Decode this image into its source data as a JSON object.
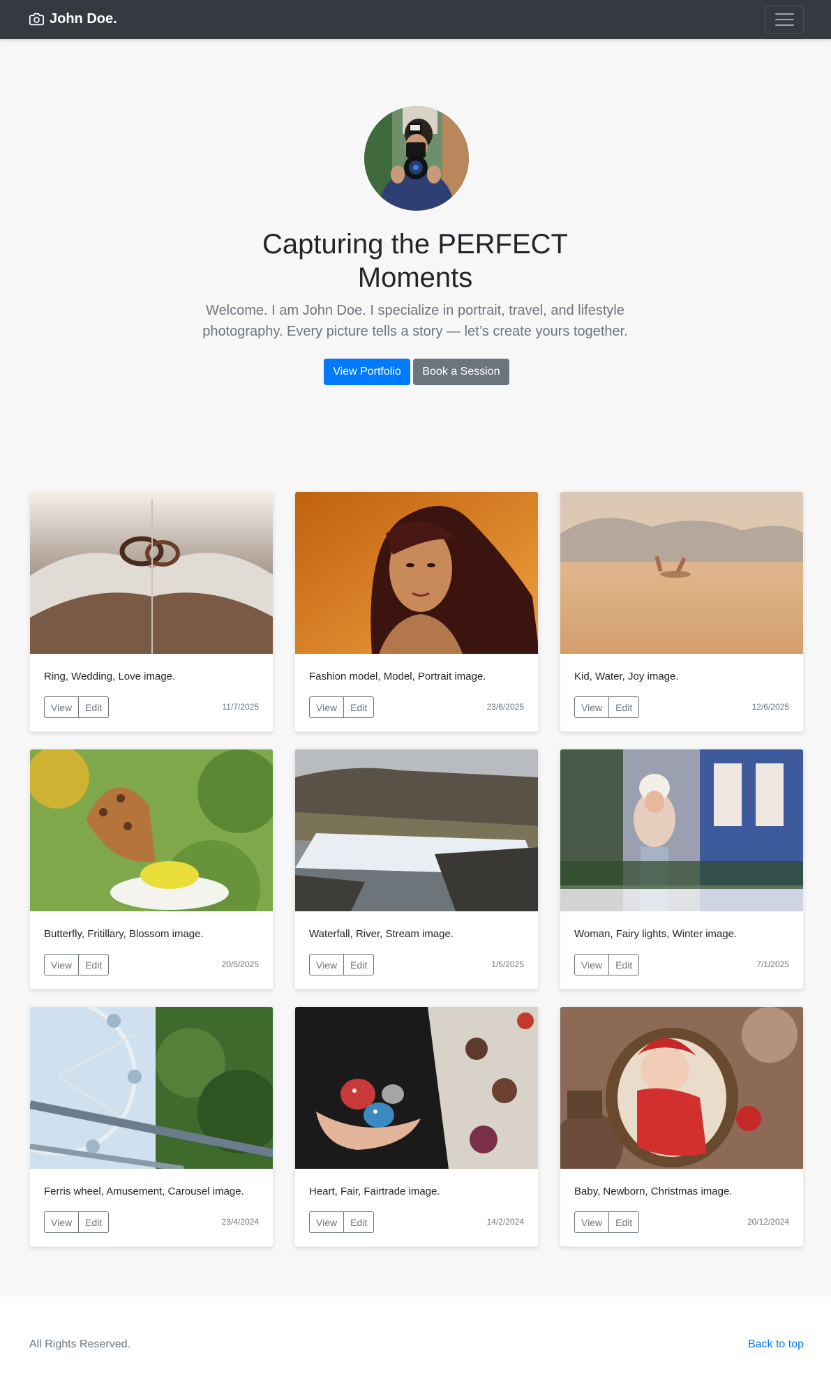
{
  "navbar": {
    "brand": "John Doe.",
    "brand_icon": "camera-icon",
    "toggler_icon": "hamburger-icon"
  },
  "hero": {
    "avatar": "photographer-avatar",
    "title": "Capturing the PERFECT Moments",
    "lead": "Welcome. I am John Doe. I specialize in portrait, travel, and lifestyle photography. Every picture tells a story — let’s create yours together.",
    "primary_button": "View Portfolio",
    "secondary_button": "Book a Session"
  },
  "gallery": {
    "view_label": "View",
    "edit_label": "Edit",
    "cards": [
      {
        "caption": "Ring, Wedding, Love image.",
        "date": "11/7/2025"
      },
      {
        "caption": "Fashion model, Model, Portrait image.",
        "date": "23/6/2025"
      },
      {
        "caption": "Kid, Water, Joy image.",
        "date": "12/6/2025"
      },
      {
        "caption": "Butterfly, Fritillary, Blossom image.",
        "date": "20/5/2025"
      },
      {
        "caption": "Waterfall, River, Stream image.",
        "date": "1/5/2025"
      },
      {
        "caption": "Woman, Fairy lights, Winter image.",
        "date": "7/1/2025"
      },
      {
        "caption": "Ferris wheel, Amusement, Carousel image.",
        "date": "23/4/2024"
      },
      {
        "caption": "Heart, Fair, Fairtrade image.",
        "date": "14/2/2024"
      },
      {
        "caption": "Baby, Newborn, Christmas image.",
        "date": "20/12/2024"
      }
    ]
  },
  "footer": {
    "copyright": "All Rights Reserved.",
    "back_to_top": "Back to top"
  },
  "colors": {
    "navbar": "#343a40",
    "primary": "#007bff",
    "secondary": "#6c757d",
    "background": "#f7f7f7"
  }
}
